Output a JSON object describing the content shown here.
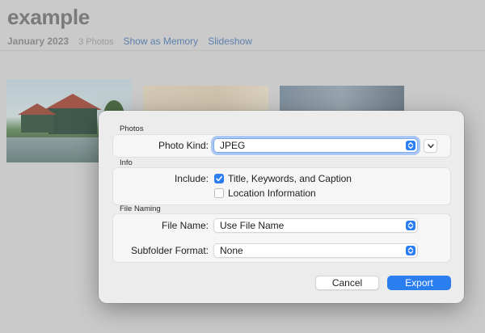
{
  "background": {
    "title": "example",
    "date": "January 2023",
    "count": "3 Photos",
    "links": [
      "Show as Memory",
      "Slideshow"
    ]
  },
  "dialog": {
    "sections": {
      "photos": {
        "label": "Photos",
        "photo_kind_label": "Photo Kind:",
        "photo_kind_value": "JPEG"
      },
      "info": {
        "label": "Info",
        "include_label": "Include:",
        "options": [
          {
            "label": "Title, Keywords, and Caption",
            "checked": true
          },
          {
            "label": "Location Information",
            "checked": false
          }
        ]
      },
      "file_naming": {
        "label": "File Naming",
        "file_name_label": "File Name:",
        "file_name_value": "Use File Name",
        "subfolder_label": "Subfolder Format:",
        "subfolder_value": "None"
      }
    },
    "buttons": {
      "cancel": "Cancel",
      "export": "Export"
    }
  },
  "colors": {
    "accent": "#2b7ef0",
    "dialog_bg": "#ececec",
    "dimmed_bg": "#cacaca"
  },
  "icons": [
    "up-down-chevron-icon",
    "chevron-down-icon",
    "checkmark-icon"
  ]
}
